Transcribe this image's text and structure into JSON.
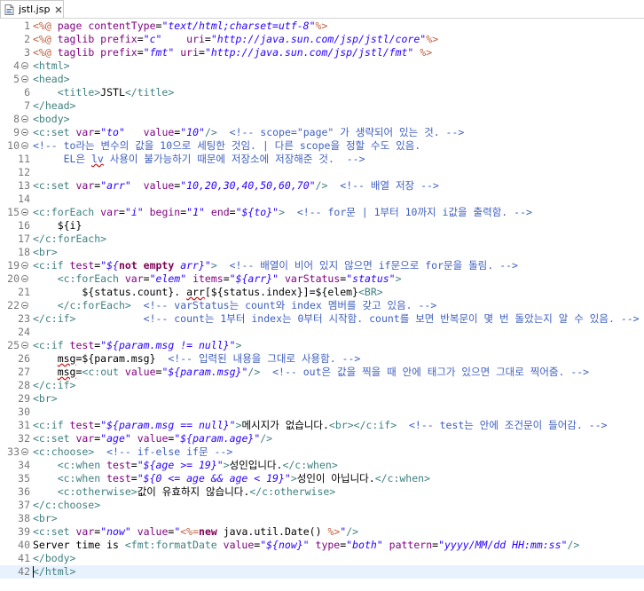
{
  "tab": {
    "title": "jstl.jsp",
    "icon": "jsp-file-icon",
    "close_icon": "close-icon"
  },
  "editor": {
    "current_line": 42,
    "lines": [
      {
        "no": "1",
        "fold": false,
        "seg": [
          [
            "jsp",
            "<%@ "
          ],
          [
            "attr",
            "page "
          ],
          [
            "attr",
            "contentType"
          ],
          [
            "plain",
            "="
          ],
          [
            "val",
            "\"text/html;charset=utf-8\""
          ],
          [
            "jsp",
            "%>"
          ]
        ]
      },
      {
        "no": "2",
        "fold": false,
        "seg": [
          [
            "jsp",
            "<%@ "
          ],
          [
            "attr",
            "taglib "
          ],
          [
            "attr",
            "prefix"
          ],
          [
            "plain",
            "="
          ],
          [
            "val",
            "\"c\""
          ],
          [
            "plain",
            "    "
          ],
          [
            "attr",
            "uri"
          ],
          [
            "plain",
            "="
          ],
          [
            "val",
            "\"http://java.sun.com/jsp/jstl/core\""
          ],
          [
            "jsp",
            "%>"
          ]
        ]
      },
      {
        "no": "3",
        "fold": false,
        "seg": [
          [
            "jsp",
            "<%@ "
          ],
          [
            "attr",
            "taglib "
          ],
          [
            "attr",
            "prefix"
          ],
          [
            "plain",
            "="
          ],
          [
            "val",
            "\"fmt\""
          ],
          [
            "plain",
            " "
          ],
          [
            "attr",
            "uri"
          ],
          [
            "plain",
            "="
          ],
          [
            "val",
            "\"http://java.sun.com/jsp/jstl/fmt\""
          ],
          [
            "plain",
            " "
          ],
          [
            "jsp",
            "%>"
          ]
        ]
      },
      {
        "no": "4",
        "fold": true,
        "seg": [
          [
            "tag",
            "<html>"
          ]
        ]
      },
      {
        "no": "5",
        "fold": true,
        "seg": [
          [
            "tag",
            "<head>"
          ]
        ]
      },
      {
        "no": "6",
        "fold": false,
        "seg": [
          [
            "plain",
            "    "
          ],
          [
            "tag",
            "<title>"
          ],
          [
            "plain",
            "JSTL"
          ],
          [
            "tag",
            "</title>"
          ]
        ]
      },
      {
        "no": "7",
        "fold": false,
        "seg": [
          [
            "tag",
            "</head>"
          ]
        ]
      },
      {
        "no": "8",
        "fold": true,
        "seg": [
          [
            "tag",
            "<body>"
          ]
        ]
      },
      {
        "no": "9",
        "fold": true,
        "seg": [
          [
            "tag",
            "<c:set "
          ],
          [
            "attr",
            "var"
          ],
          [
            "plain",
            "="
          ],
          [
            "val",
            "\"to\""
          ],
          [
            "plain",
            "   "
          ],
          [
            "attr",
            "value"
          ],
          [
            "plain",
            "="
          ],
          [
            "val",
            "\"10\""
          ],
          [
            "tag",
            "/>"
          ],
          [
            "plain",
            "  "
          ],
          [
            "com",
            "<!-- scope=\"page\" 가 생략되어 있는 것. -->"
          ]
        ]
      },
      {
        "no": "10",
        "fold": true,
        "seg": [
          [
            "com",
            "<!-- to라는 변수의 값을 10으로 세팅한 것임. | 다른 scope을 정할 수도 있음."
          ]
        ]
      },
      {
        "no": "11",
        "fold": false,
        "seg": [
          [
            "com",
            "     EL은 "
          ],
          [
            "comerr",
            "lv"
          ],
          [
            "com",
            " 사용이 불가능하기 때문에 저장소에 저장해준 것.  -->"
          ]
        ]
      },
      {
        "no": "12",
        "fold": false,
        "seg": []
      },
      {
        "no": "13",
        "fold": false,
        "seg": [
          [
            "tag",
            "<c:set "
          ],
          [
            "attr",
            "var"
          ],
          [
            "plain",
            "="
          ],
          [
            "val",
            "\"arr\""
          ],
          [
            "plain",
            "  "
          ],
          [
            "attr",
            "value"
          ],
          [
            "plain",
            "="
          ],
          [
            "val",
            "\"10,20,30,40,50,60,70\""
          ],
          [
            "tag",
            "/>"
          ],
          [
            "plain",
            "  "
          ],
          [
            "com",
            "<!-- 배열 저장 -->"
          ]
        ]
      },
      {
        "no": "14",
        "fold": false,
        "seg": []
      },
      {
        "no": "15",
        "fold": true,
        "seg": [
          [
            "tag",
            "<c:forEach "
          ],
          [
            "attr",
            "var"
          ],
          [
            "plain",
            "="
          ],
          [
            "val",
            "\"i\""
          ],
          [
            "plain",
            " "
          ],
          [
            "attr",
            "begin"
          ],
          [
            "plain",
            "="
          ],
          [
            "val",
            "\"1\""
          ],
          [
            "plain",
            " "
          ],
          [
            "attr",
            "end"
          ],
          [
            "plain",
            "="
          ],
          [
            "val",
            "\"${to}\""
          ],
          [
            "tag",
            ">"
          ],
          [
            "plain",
            "  "
          ],
          [
            "com",
            "<!-- for문 | 1부터 10까지 i값을 출력함. -->"
          ]
        ]
      },
      {
        "no": "16",
        "fold": false,
        "seg": [
          [
            "plain",
            "    ${i}"
          ]
        ]
      },
      {
        "no": "17",
        "fold": false,
        "seg": [
          [
            "tag",
            "</c:forEach>"
          ]
        ]
      },
      {
        "no": "18",
        "fold": false,
        "seg": [
          [
            "tag",
            "<br>"
          ]
        ]
      },
      {
        "no": "19",
        "fold": true,
        "seg": [
          [
            "tag",
            "<c:if "
          ],
          [
            "attr",
            "test"
          ],
          [
            "plain",
            "="
          ],
          [
            "val",
            "\"${"
          ],
          [
            "kw",
            "not empty"
          ],
          [
            "val",
            " arr}\""
          ],
          [
            "tag",
            ">"
          ],
          [
            "plain",
            "  "
          ],
          [
            "com",
            "<!-- 배열이 비어 있지 않으면 if문으로 for문을 돌림. -->"
          ]
        ]
      },
      {
        "no": "20",
        "fold": true,
        "seg": [
          [
            "plain",
            "    "
          ],
          [
            "tag",
            "<c:forEach "
          ],
          [
            "attr",
            "var"
          ],
          [
            "plain",
            "="
          ],
          [
            "val",
            "\"elem\""
          ],
          [
            "plain",
            " "
          ],
          [
            "attr",
            "items"
          ],
          [
            "plain",
            "="
          ],
          [
            "val",
            "\"${arr}\""
          ],
          [
            "plain",
            " "
          ],
          [
            "attr",
            "varStatus"
          ],
          [
            "plain",
            "="
          ],
          [
            "val",
            "\"status\""
          ],
          [
            "tag",
            ">"
          ]
        ]
      },
      {
        "no": "21",
        "fold": false,
        "seg": [
          [
            "plain",
            "        ${status.count}. "
          ],
          [
            "err",
            "arr"
          ],
          [
            "plain",
            "[${status.index}]=${elem}"
          ],
          [
            "tag",
            "<BR>"
          ]
        ]
      },
      {
        "no": "22",
        "fold": true,
        "seg": [
          [
            "plain",
            "    "
          ],
          [
            "tag",
            "</c:forEach>"
          ],
          [
            "plain",
            "  "
          ],
          [
            "com",
            "<!-- varStatus는 count와 index 멤버를 갖고 있음. -->"
          ]
        ]
      },
      {
        "no": "23",
        "fold": false,
        "seg": [
          [
            "tag",
            "</c:if>"
          ],
          [
            "plain",
            "           "
          ],
          [
            "com",
            "<!-- count는 1부터 index는 0부터 시작함. count를 보면 반복문이 몇 번 돌았는지 알 수 있음. -->"
          ]
        ]
      },
      {
        "no": "24",
        "fold": false,
        "seg": []
      },
      {
        "no": "25",
        "fold": true,
        "seg": [
          [
            "tag",
            "<c:if "
          ],
          [
            "attr",
            "test"
          ],
          [
            "plain",
            "="
          ],
          [
            "val",
            "\"${param.msg != null}\""
          ],
          [
            "tag",
            ">"
          ]
        ]
      },
      {
        "no": "26",
        "fold": false,
        "seg": [
          [
            "plain",
            "    "
          ],
          [
            "err",
            "msg"
          ],
          [
            "plain",
            "=${param.msg}  "
          ],
          [
            "com",
            "<!-- 입력된 내용을 그대로 사용함. -->"
          ]
        ]
      },
      {
        "no": "27",
        "fold": false,
        "seg": [
          [
            "plain",
            "    "
          ],
          [
            "err",
            "msg"
          ],
          [
            "plain",
            "="
          ],
          [
            "tag",
            "<c:out "
          ],
          [
            "attr",
            "value"
          ],
          [
            "plain",
            "="
          ],
          [
            "val",
            "\"${param.msg}\""
          ],
          [
            "tag",
            "/>"
          ],
          [
            "plain",
            "  "
          ],
          [
            "com",
            "<!-- out은 값을 찍을 때 안에 태그가 있으면 그대로 찍어줌. -->"
          ]
        ]
      },
      {
        "no": "28",
        "fold": false,
        "seg": [
          [
            "tag",
            "</c:if>"
          ]
        ]
      },
      {
        "no": "29",
        "fold": false,
        "seg": [
          [
            "tag",
            "<br>"
          ]
        ]
      },
      {
        "no": "30",
        "fold": false,
        "seg": []
      },
      {
        "no": "31",
        "fold": false,
        "seg": [
          [
            "tag",
            "<c:if "
          ],
          [
            "attr",
            "test"
          ],
          [
            "plain",
            "="
          ],
          [
            "val",
            "\"${param.msg == null}\""
          ],
          [
            "tag",
            ">"
          ],
          [
            "plain",
            "메시지가 없습니다."
          ],
          [
            "tag",
            "<br></c:if>"
          ],
          [
            "plain",
            "  "
          ],
          [
            "com",
            "<!-- test는 안에 조건문이 들어감. -->"
          ]
        ]
      },
      {
        "no": "32",
        "fold": false,
        "seg": [
          [
            "tag",
            "<c:set "
          ],
          [
            "attr",
            "var"
          ],
          [
            "plain",
            "="
          ],
          [
            "val",
            "\"age\""
          ],
          [
            "plain",
            " "
          ],
          [
            "attr",
            "value"
          ],
          [
            "plain",
            "="
          ],
          [
            "val",
            "\"${param.age}\""
          ],
          [
            "tag",
            "/>"
          ]
        ]
      },
      {
        "no": "33",
        "fold": true,
        "seg": [
          [
            "tag",
            "<c:choose>"
          ],
          [
            "plain",
            "  "
          ],
          [
            "com",
            "<!-- if-else if문 -->"
          ]
        ]
      },
      {
        "no": "34",
        "fold": false,
        "seg": [
          [
            "plain",
            "    "
          ],
          [
            "tag",
            "<c:when "
          ],
          [
            "attr",
            "test"
          ],
          [
            "plain",
            "="
          ],
          [
            "val",
            "\"${age >= 19}\""
          ],
          [
            "tag",
            ">"
          ],
          [
            "plain",
            "성인입니다."
          ],
          [
            "tag",
            "</c:when>"
          ]
        ]
      },
      {
        "no": "35",
        "fold": false,
        "seg": [
          [
            "plain",
            "    "
          ],
          [
            "tag",
            "<c:when "
          ],
          [
            "attr",
            "test"
          ],
          [
            "plain",
            "="
          ],
          [
            "val",
            "\"${0 <= age && age < 19}\""
          ],
          [
            "tag",
            ">"
          ],
          [
            "plain",
            "성인이 아닙니다."
          ],
          [
            "tag",
            "</c:when>"
          ]
        ]
      },
      {
        "no": "36",
        "fold": false,
        "seg": [
          [
            "plain",
            "    "
          ],
          [
            "tag",
            "<c:otherwise>"
          ],
          [
            "plain",
            "값이 유효하지 않습니다."
          ],
          [
            "tag",
            "</c:otherwise>"
          ]
        ]
      },
      {
        "no": "37",
        "fold": false,
        "seg": [
          [
            "tag",
            "</c:choose>"
          ]
        ]
      },
      {
        "no": "38",
        "fold": false,
        "seg": [
          [
            "tag",
            "<br>"
          ]
        ]
      },
      {
        "no": "39",
        "fold": false,
        "seg": [
          [
            "tag",
            "<c:set "
          ],
          [
            "attr",
            "var"
          ],
          [
            "plain",
            "="
          ],
          [
            "val",
            "\"now\""
          ],
          [
            "plain",
            " "
          ],
          [
            "attr",
            "value"
          ],
          [
            "plain",
            "="
          ],
          [
            "val",
            "\""
          ],
          [
            "jsp",
            "<%="
          ],
          [
            "kw",
            "new"
          ],
          [
            "plain",
            " java.util.Date() "
          ],
          [
            "jsp",
            "%>"
          ],
          [
            "val",
            "\""
          ],
          [
            "tag",
            "/>"
          ]
        ]
      },
      {
        "no": "40",
        "fold": false,
        "seg": [
          [
            "plain",
            "Server time is "
          ],
          [
            "tag",
            "<fmt:formatDate "
          ],
          [
            "attr",
            "value"
          ],
          [
            "plain",
            "="
          ],
          [
            "val",
            "\"${now}\""
          ],
          [
            "plain",
            " "
          ],
          [
            "attr",
            "type"
          ],
          [
            "plain",
            "="
          ],
          [
            "val",
            "\"both\""
          ],
          [
            "plain",
            " "
          ],
          [
            "attr",
            "pattern"
          ],
          [
            "plain",
            "="
          ],
          [
            "val",
            "\"yyyy/MM/dd HH:mm:ss\""
          ],
          [
            "tag",
            "/>"
          ]
        ]
      },
      {
        "no": "41",
        "fold": false,
        "seg": [
          [
            "tag",
            "</body>"
          ]
        ]
      },
      {
        "no": "42",
        "fold": false,
        "seg": [
          [
            "tag",
            "</html>"
          ]
        ]
      }
    ]
  }
}
